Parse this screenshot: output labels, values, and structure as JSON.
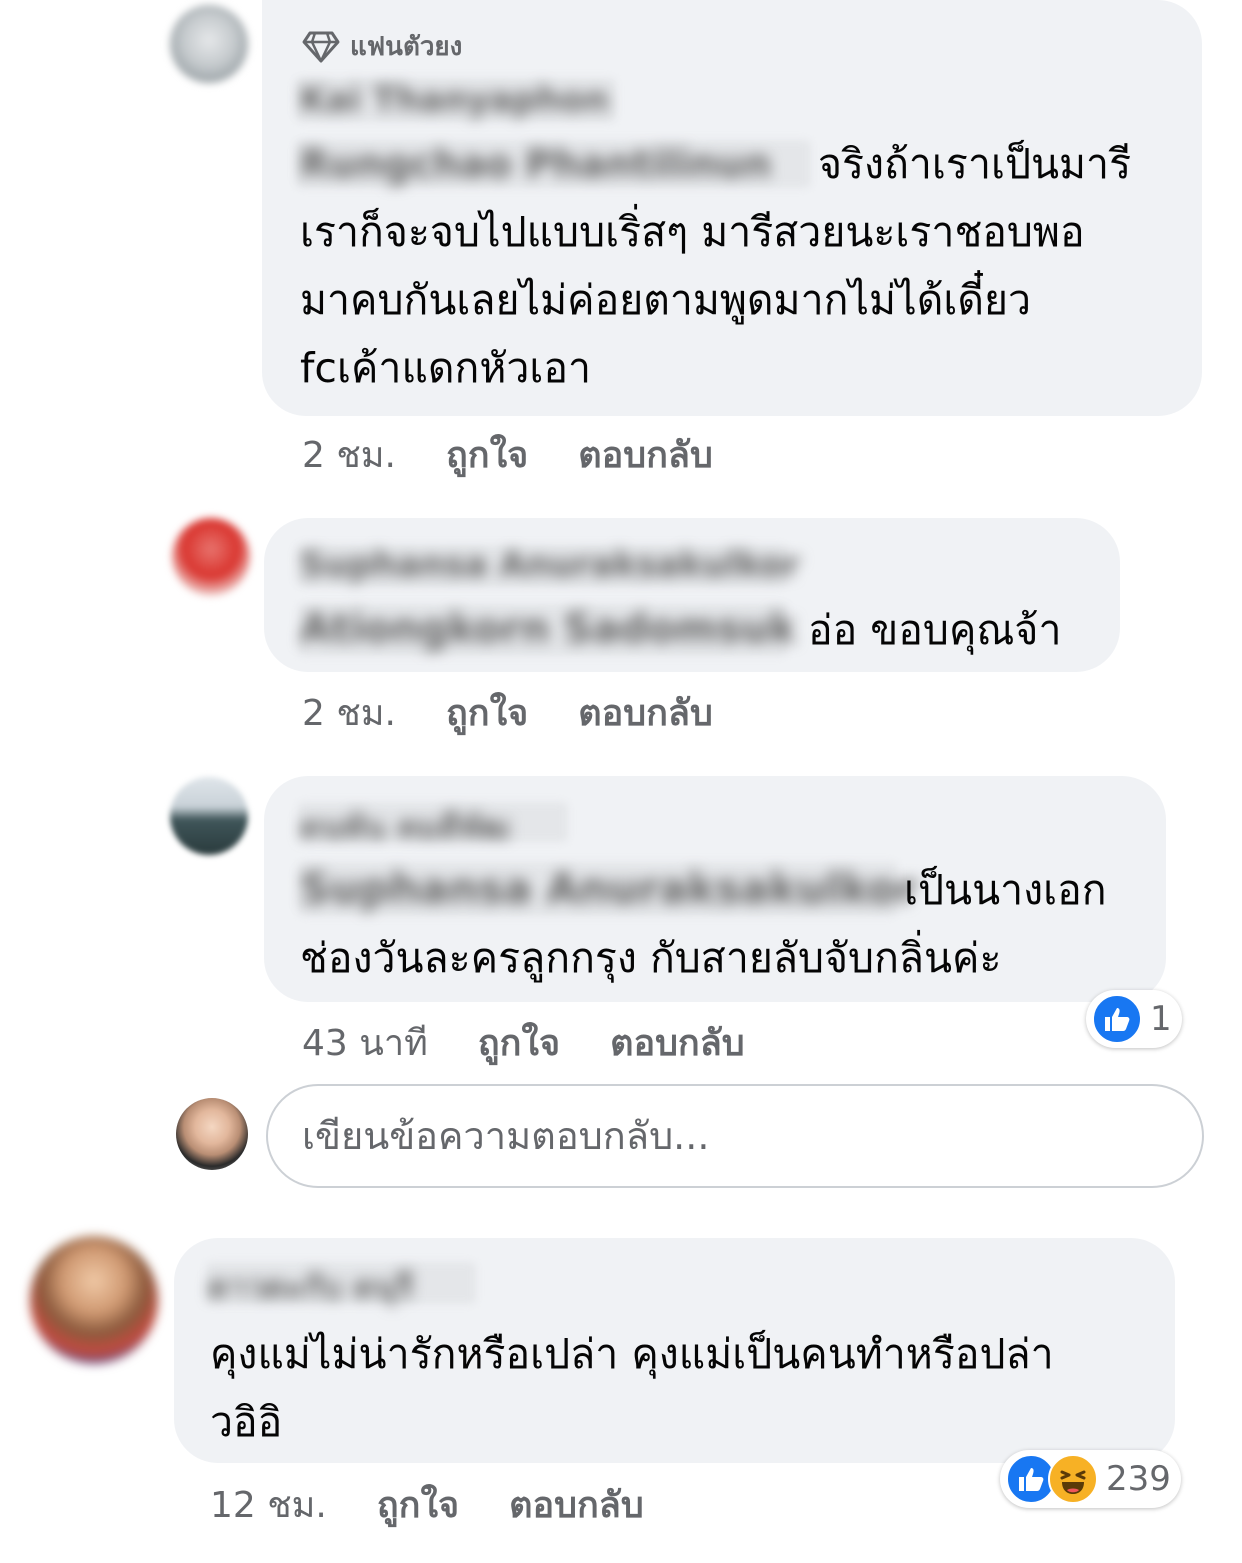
{
  "comments": [
    {
      "badge": "แฟนตัวยง",
      "name_blurred": "Kai Thanyaphon",
      "tag_blurred": "Rungchao Phantilinun",
      "text_lines": [
        "จริงถ้าเราเป็นมารี",
        "เราก็จะจบไปแบบเริ่สๆ มารีสวยนะเราชอบพอ",
        "มาคบกันเลยไม่ค่อยตามพูดมากไม่ได้เดี๋ยว",
        "fcเค้าแดกหัวเอา"
      ],
      "time": "2 ชม.",
      "like": "ถูกใจ",
      "reply": "ตอบกลับ"
    },
    {
      "name_blurred": "Suphansa Anuraksakulkor",
      "tag_blurred": "Ationgkorn Sadomsuk",
      "text_lines": [
        "อ่อ ขอบคุณจ้า"
      ],
      "time": "2 ชม.",
      "like": "ถูกใจ",
      "reply": "ตอบกลับ"
    },
    {
      "name_blurred": "ดนพัน คมดีพัฒ",
      "tag_blurred": "Suphansa Anuraksakulkor",
      "text_lines": [
        "เป็นนางเอก",
        "ช่องวันละครลูกกรุง กับสายลับจับกลิ่นค่ะ"
      ],
      "time": "43 นาที",
      "like": "ถูกใจ",
      "reply": "ตอบกลับ",
      "reaction_count": "1"
    },
    {
      "name_blurred": "ดาวดะกับ ดนุรี",
      "text_lines": [
        "คุงแม่ไม่น่ารักหรือเปล่า คุงแม่เป็นคนทำหรือปล่า",
        "วอิอิ"
      ],
      "time": "12 ชม.",
      "like": "ถูกใจ",
      "reply": "ตอบกลับ",
      "reaction_count": "239"
    }
  ],
  "composer": {
    "placeholder": "เขียนข้อความตอบกลับ..."
  },
  "icons": {
    "badge": "diamond-icon",
    "like": "thumbs-up-icon",
    "haha": "haha-emoji-icon"
  },
  "colors": {
    "bubble": "#f0f2f5",
    "meta_text": "#65676b",
    "like_blue": "#1877f2",
    "haha_yellow": "#f7b125"
  }
}
